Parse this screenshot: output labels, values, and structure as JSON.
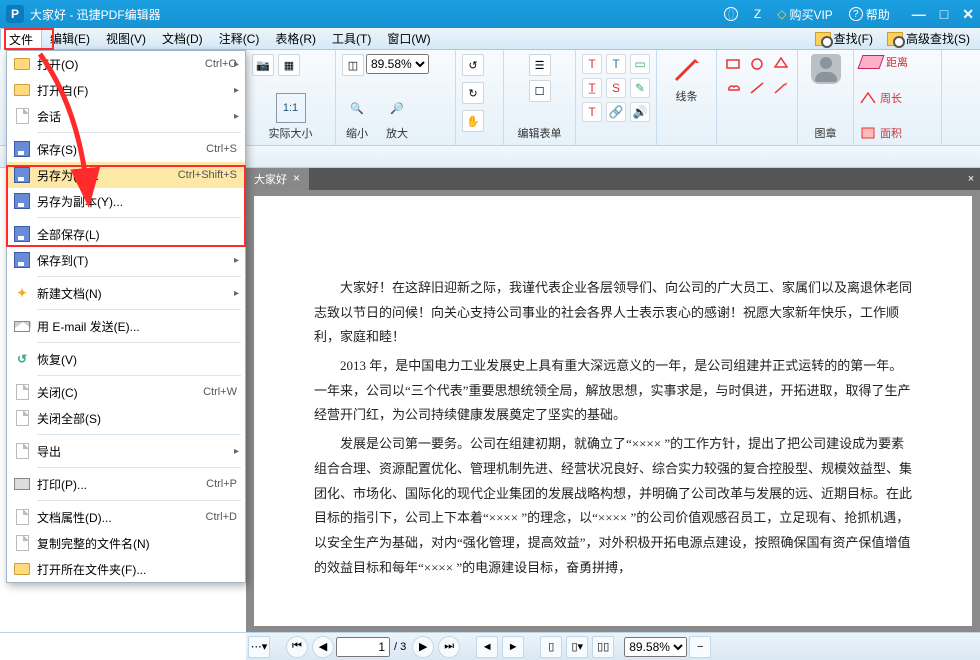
{
  "title": "大家好 - 迅捷PDF编辑器",
  "titlebar": {
    "user": "Z",
    "vip": "购买VIP",
    "help": "帮助"
  },
  "menubar": {
    "items": [
      "文件",
      "编辑(E)",
      "视图(V)",
      "文档(D)",
      "注释(C)",
      "表格(R)",
      "工具(T)",
      "窗口(W)"
    ],
    "find": "查找(F)",
    "advfind": "高级查找(S)"
  },
  "ribbon": {
    "zoom": "89.58%",
    "actual": "实际大小",
    "zoomout": "缩小",
    "zoomin": "放大",
    "editform": "编辑表单",
    "lines": "线条",
    "stamp": "图章",
    "dist": "距离",
    "perim": "周长",
    "area": "面积"
  },
  "tab": {
    "name": "大家好"
  },
  "doc": {
    "p1": "大家好！在这辞旧迎新之际，我谨代表企业各层领导们、向公司的广大员工、家属们以及离退休老同志致以节日的问候！向关心支持公司事业的社会各界人士表示衷心的感谢！祝愿大家新年快乐，工作顺利，家庭和睦！",
    "p2": "2013 年，是中国电力工业发展史上具有重大深远意义的一年，是公司组建并正式运转的的第一年。一年来，公司以“三个代表”重要思想统领全局，解放思想，实事求是，与时俱进，开拓进取，取得了生产经营开门红，为公司持续健康发展奠定了坚实的基础。",
    "p3": "发展是公司第一要务。公司在组建初期，就确立了“×××× ”的工作方针，提出了把公司建设成为要素组合合理、资源配置优化、管理机制先进、经营状况良好、综合实力较强的复合控股型、规模效益型、集团化、市场化、国际化的现代企业集团的发展战略构想，并明确了公司改革与发展的远、近期目标。在此目标的指引下，公司上下本着“×××× ”的理念，以“×××× ”的公司价值观感召员工，立足现有、抢抓机遇，以安全生产为基础，对内“强化管理，提高效益”，对外积极开拓电源点建设，按照确保国有资产保值增值的效益目标和每年“×××× ”的电源建设目标，奋勇拼搏，"
  },
  "status": {
    "page_cur": "1",
    "page_tot": "/ 3",
    "zoom": "89.58%"
  },
  "filemenu": {
    "open": {
      "t": "打开(O)",
      "s": "Ctrl+O"
    },
    "openfrom": {
      "t": "打开自(F)"
    },
    "session": {
      "t": "会话"
    },
    "save": {
      "t": "保存(S)",
      "s": "Ctrl+S"
    },
    "saveas": {
      "t": "另存为(A)...",
      "s": "Ctrl+Shift+S"
    },
    "savecopy": {
      "t": "另存为副本(Y)..."
    },
    "saveall": {
      "t": "全部保存(L)"
    },
    "saveto": {
      "t": "保存到(T)"
    },
    "newdoc": {
      "t": "新建文档(N)"
    },
    "email": {
      "t": "用 E-mail 发送(E)..."
    },
    "revert": {
      "t": "恢复(V)"
    },
    "close": {
      "t": "关闭(C)",
      "s": "Ctrl+W"
    },
    "closeall": {
      "t": "关闭全部(S)"
    },
    "export": {
      "t": "导出"
    },
    "print": {
      "t": "打印(P)...",
      "s": "Ctrl+P"
    },
    "props": {
      "t": "文档属性(D)...",
      "s": "Ctrl+D"
    },
    "copyname": {
      "t": "复制完整的文件名(N)"
    },
    "reveal": {
      "t": "打开所在文件夹(F)..."
    }
  },
  "watermark": ""
}
